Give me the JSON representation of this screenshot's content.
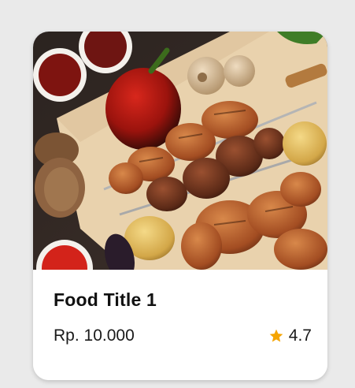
{
  "card": {
    "title": "Food Title 1",
    "price": "Rp. 10.000",
    "rating": "4.7",
    "image_icon": "grilled-meat-platter-image",
    "star_icon": "star-icon",
    "star_color": "#f5a400"
  }
}
